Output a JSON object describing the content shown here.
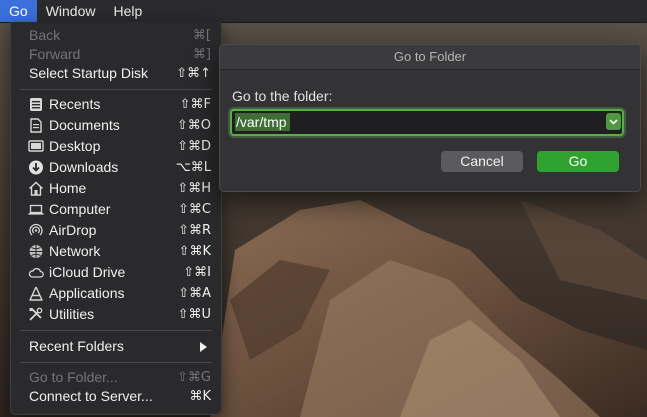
{
  "menubar": {
    "items": [
      {
        "label": "Go"
      },
      {
        "label": "Window"
      },
      {
        "label": "Help"
      }
    ]
  },
  "go_menu": {
    "items": [
      {
        "label": "Back",
        "shortcut": "⌘[",
        "disabled": true,
        "icon": ""
      },
      {
        "label": "Forward",
        "shortcut": "⌘]",
        "disabled": true,
        "icon": ""
      },
      {
        "label": "Select Startup Disk",
        "shortcut": "⇧⌘↑",
        "disabled": false,
        "icon": ""
      },
      {
        "label": "Recents",
        "shortcut": "⇧⌘F",
        "icon": "recents-icon"
      },
      {
        "label": "Documents",
        "shortcut": "⇧⌘O",
        "icon": "documents-icon"
      },
      {
        "label": "Desktop",
        "shortcut": "⇧⌘D",
        "icon": "desktop-icon"
      },
      {
        "label": "Downloads",
        "shortcut": "⌥⌘L",
        "icon": "downloads-icon"
      },
      {
        "label": "Home",
        "shortcut": "⇧⌘H",
        "icon": "home-icon"
      },
      {
        "label": "Computer",
        "shortcut": "⇧⌘C",
        "icon": "computer-icon"
      },
      {
        "label": "AirDrop",
        "shortcut": "⇧⌘R",
        "icon": "airdrop-icon"
      },
      {
        "label": "Network",
        "shortcut": "⇧⌘K",
        "icon": "network-icon"
      },
      {
        "label": "iCloud Drive",
        "shortcut": "⇧⌘I",
        "icon": "icloud-icon"
      },
      {
        "label": "Applications",
        "shortcut": "⇧⌘A",
        "icon": "applications-icon"
      },
      {
        "label": "Utilities",
        "shortcut": "⇧⌘U",
        "icon": "utilities-icon"
      },
      {
        "label": "Recent Folders",
        "submenu": true
      },
      {
        "label": "Go to Folder...",
        "shortcut": "⇧⌘G",
        "disabled": true
      },
      {
        "label": "Connect to Server...",
        "shortcut": "⌘K",
        "disabled": false
      }
    ]
  },
  "dialog": {
    "title": "Go to Folder",
    "prompt": "Go to the folder:",
    "path_value": "/var/tmp",
    "cancel_label": "Cancel",
    "go_label": "Go"
  },
  "colors": {
    "accent_green": "#2fa22f",
    "menu_highlight": "#3b6fd9"
  }
}
